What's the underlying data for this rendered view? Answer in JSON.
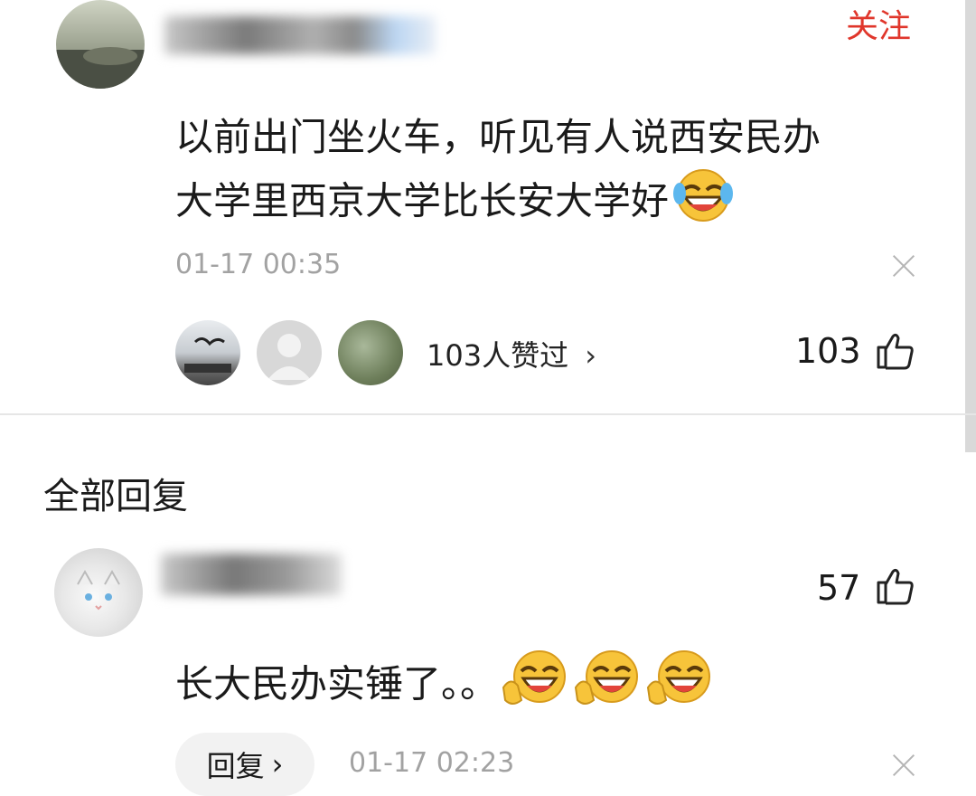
{
  "post": {
    "follow_label": "关注",
    "content_line1": "以前出门坐火车，听见有人说西安民办",
    "content_line2": "大学里西京大学比长安大学好",
    "timestamp": "01-17 00:35",
    "likers_text": "103人赞过",
    "like_count": "103"
  },
  "replies": {
    "section_title": "全部回复",
    "items": [
      {
        "content": "长大民办实锤了。。",
        "like_count": "57",
        "reply_label": "回复",
        "timestamp": "01-17 02:23"
      }
    ]
  },
  "icons": {
    "like": "thumbs-up-icon",
    "close": "close-icon",
    "chevron": "chevron-right-icon",
    "laugh": "rofl-emoji-icon"
  },
  "colors": {
    "follow": "#e0362b",
    "divider": "#e6e6e6",
    "muted": "#a2a2a2"
  }
}
